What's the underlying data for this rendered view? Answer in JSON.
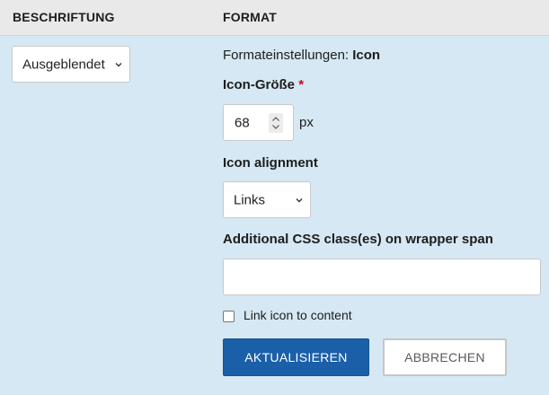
{
  "header": {
    "col_left": "BESCHRIFTUNG",
    "col_right": "FORMAT"
  },
  "label_display": {
    "selected": "Ausgeblendet"
  },
  "format": {
    "settings_prefix": "Formateinstellungen:",
    "settings_value": "Icon",
    "icon_size_label": "Icon-Größe",
    "required_mark": "*",
    "icon_size_value": "68",
    "icon_size_unit": "px",
    "alignment_label": "Icon alignment",
    "alignment_selected": "Links",
    "css_label": "Additional CSS class(es) on wrapper span",
    "css_value": "",
    "link_label": "Link icon to content",
    "link_checked": false
  },
  "actions": {
    "update_label": "AKTUALISIEREN",
    "cancel_label": "ABBRECHEN"
  },
  "colors": {
    "background": "#d5e8f3",
    "header_bg": "#e9e9e9",
    "primary": "#1a5fa8",
    "required": "#d0021b"
  },
  "icons": {
    "select_arrow": "chevron-down-icon",
    "spinner": "spinner-arrows-icon"
  }
}
